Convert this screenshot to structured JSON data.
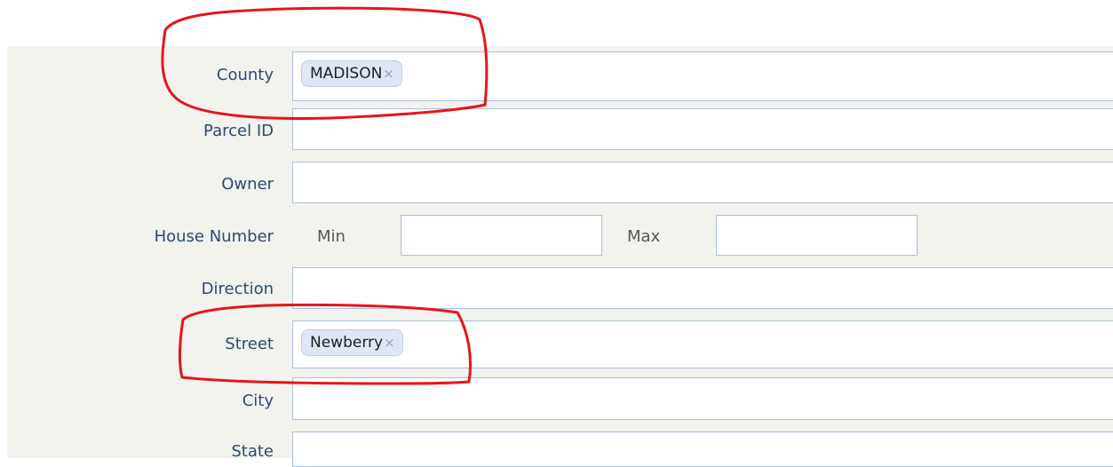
{
  "form": {
    "county": {
      "label": "County",
      "tag": "MADISON",
      "remove_glyph": "×"
    },
    "parcel_id": {
      "label": "Parcel ID"
    },
    "owner": {
      "label": "Owner"
    },
    "house_number": {
      "label": "House Number",
      "min_label": "Min",
      "max_label": "Max"
    },
    "direction": {
      "label": "Direction"
    },
    "street": {
      "label": "Street",
      "tag": "Newberry",
      "remove_glyph": "×"
    },
    "city": {
      "label": "City"
    },
    "state": {
      "label": "State"
    }
  },
  "annotation": {
    "color": "#e8141b"
  }
}
